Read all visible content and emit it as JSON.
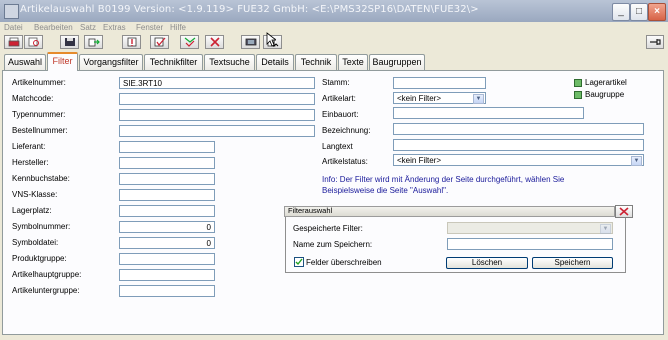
{
  "window": {
    "title": "Artikelauswahl B0199 Version: <1.9.119> FUE32 GmbH: <E:\\PMS32SP16\\DATEN\\FUE32\\>",
    "controls": {
      "minimize": "_",
      "maximize": "□",
      "close": "×"
    }
  },
  "menu": [
    "Datei",
    "Bearbeiten",
    "Satz",
    "Extras",
    "Fenster",
    "Hilfe"
  ],
  "toolbar": {
    "icons": [
      "print-icon",
      "print-preview-icon",
      "save-icon",
      "export-icon",
      "new-record-icon",
      "edit-check-icon",
      "apply-filter-icon",
      "clear-filter-icon",
      "report-icon",
      "copy-cursor-icon"
    ],
    "right_icon": "pin-icon"
  },
  "tabs": [
    {
      "label": "Auswahl",
      "active": false
    },
    {
      "label": "Filter",
      "active": true
    },
    {
      "label": "Vorgangsfilter",
      "active": false
    },
    {
      "label": "Technikfilter",
      "active": false
    },
    {
      "label": "Textsuche",
      "active": false
    },
    {
      "label": "Details",
      "active": false
    },
    {
      "label": "Technik",
      "active": false
    },
    {
      "label": "Texte",
      "active": false
    },
    {
      "label": "Baugruppen",
      "active": false
    }
  ],
  "left_fields": [
    {
      "label": "Artikelnummer:",
      "value": "SIE.3RT10"
    },
    {
      "label": "Matchcode:",
      "value": ""
    },
    {
      "label": "Typennummer:",
      "value": ""
    },
    {
      "label": "Bestellnummer:",
      "value": ""
    }
  ],
  "left_fields2": [
    {
      "label": "Lieferant:",
      "value": ""
    },
    {
      "label": "Hersteller:",
      "value": ""
    },
    {
      "label": "Kennbuchstabe:",
      "value": ""
    },
    {
      "label": "VNS-Klasse:",
      "value": ""
    },
    {
      "label": "Lagerplatz:",
      "value": ""
    },
    {
      "label": "Symbolnummer:",
      "value": "0"
    },
    {
      "label": "Symboldatei:",
      "value": "0"
    },
    {
      "label": "Produktgruppe:",
      "value": ""
    },
    {
      "label": "Artikelhauptgruppe:",
      "value": ""
    },
    {
      "label": "Artikeluntergruppe:",
      "value": ""
    }
  ],
  "right_fields": {
    "stamm": {
      "label": "Stamm:",
      "value": ""
    },
    "artikelart": {
      "label": "Artikelart:",
      "value": "<kein Filter>"
    },
    "einbauort": {
      "label": "Einbauort:",
      "value": ""
    },
    "bezeichnung": {
      "label": "Bezeichnung:",
      "value": ""
    },
    "langtext": {
      "label": "Langtext",
      "value": ""
    },
    "artikelstatus": {
      "label": "Artikelstatus:",
      "value": "<kein Filter>"
    }
  },
  "legend": [
    {
      "label": "Lagerartikel",
      "color": "#6dbb67"
    },
    {
      "label": "Baugruppe",
      "color": "#6dbb67"
    }
  ],
  "info_text": [
    "Info: Der Filter wird mit Änderung der Seite durchgeführt, wählen Sie",
    "Beispielsweise die Seite \"Auswahl\"."
  ],
  "filterauswahl": {
    "title": "Filterauswahl",
    "saved_filter_label": "Gespeicherte Filter:",
    "saved_filter_value": "",
    "save_name_label": "Name zum Speichern:",
    "save_name_value": "",
    "overwrite_label": "Felder überschreiben",
    "overwrite_checked": true,
    "delete_button": "Löschen",
    "save_button": "Speichern"
  },
  "colors": {
    "active_tab_accent": "#e68b2c",
    "info_text": "#1a1a9a",
    "legend_green": "#6dbb67"
  }
}
